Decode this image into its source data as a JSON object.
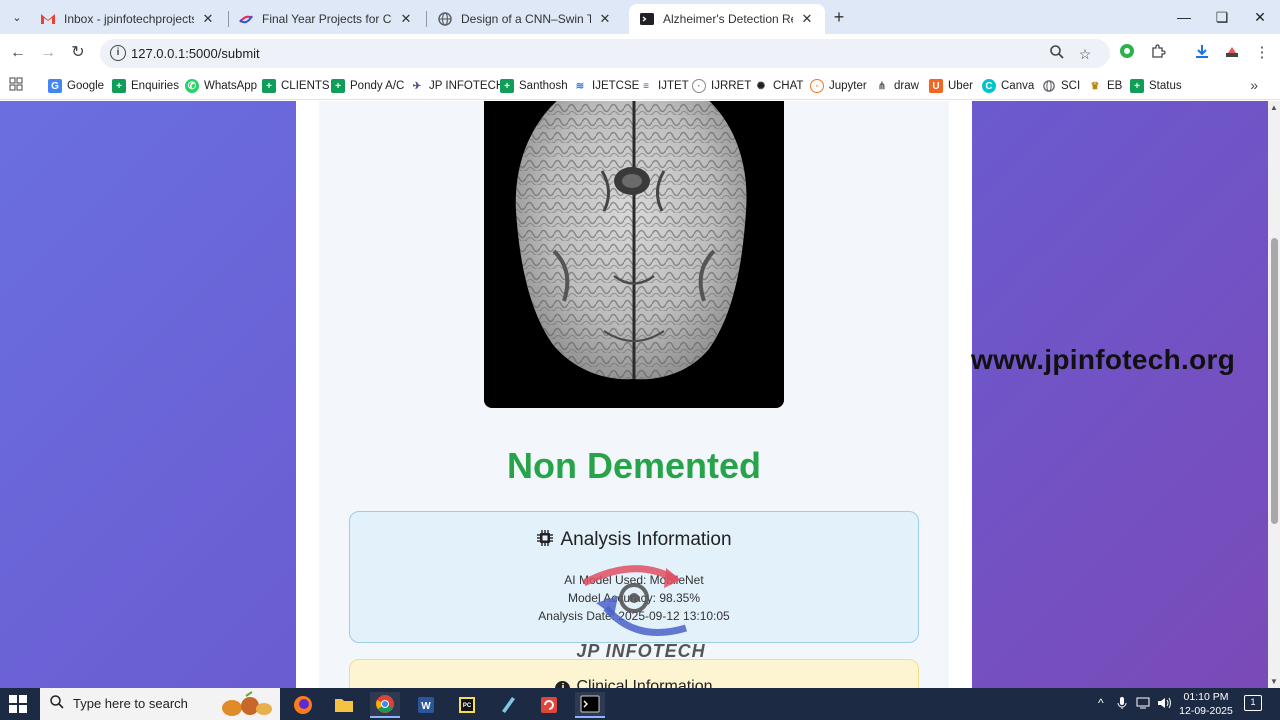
{
  "browser": {
    "tabs": [
      {
        "title": "Inbox - jpinfotechprojects@gm",
        "favicon": "gmail-icon",
        "favicon_color": "#ea4335",
        "active": false
      },
      {
        "title": "Final Year Projects for Compute",
        "favicon": "jp-logo-icon",
        "favicon_color": "#4a4a8a",
        "active": false
      },
      {
        "title": "Design of a CNN–Swin Transfor",
        "favicon": "globe-icon",
        "favicon_color": "#5f6368",
        "active": false
      },
      {
        "title": "Alzheimer's Detection Results",
        "favicon": "terminal-icon",
        "favicon_color": "#202124",
        "active": true
      }
    ],
    "url": "127.0.0.1:5000/submit",
    "bookmarks": [
      {
        "label": "Google",
        "icon": "google-icon",
        "color": "#4285f4"
      },
      {
        "label": "Enquiries",
        "icon": "sheets-icon",
        "color": "#0f9d58"
      },
      {
        "label": "WhatsApp",
        "icon": "whatsapp-icon",
        "color": "#25d366"
      },
      {
        "label": "CLIENTS",
        "icon": "sheets-icon",
        "color": "#0f9d58"
      },
      {
        "label": "Pondy A/C",
        "icon": "sheets-icon",
        "color": "#0f9d58"
      },
      {
        "label": "JP INFOTECH",
        "icon": "jp-logo-icon",
        "color": "#4a4a8a"
      },
      {
        "label": "Santhosh",
        "icon": "sheets-icon",
        "color": "#0f9d58"
      },
      {
        "label": "IJETCSE",
        "icon": "ijetcse-icon",
        "color": "#3a7bd5"
      },
      {
        "label": "IJTET",
        "icon": "ijtet-icon",
        "color": "#7b3fa0"
      },
      {
        "label": "IJRRET",
        "icon": "ijrret-icon",
        "color": "#888888"
      },
      {
        "label": "CHAT",
        "icon": "openai-icon",
        "color": "#202124"
      },
      {
        "label": "Jupyter",
        "icon": "jupyter-icon",
        "color": "#f37626"
      },
      {
        "label": "draw",
        "icon": "drawio-icon",
        "color": "#555555"
      },
      {
        "label": "Uber",
        "icon": "uber-icon",
        "color": "#f26522"
      },
      {
        "label": "Canva",
        "icon": "canva-icon",
        "color": "#00c4cc"
      },
      {
        "label": "SCI",
        "icon": "globe-icon",
        "color": "#5f6368"
      },
      {
        "label": "EB",
        "icon": "eb-icon",
        "color": "#b8860b"
      },
      {
        "label": "Status",
        "icon": "sheets-icon",
        "color": "#0f9d58"
      }
    ]
  },
  "page": {
    "result_label": "Non Demented",
    "result_color": "#27a34a",
    "analysis": {
      "title": "Analysis Information",
      "model_line": "AI Model Used: MobileNet",
      "accuracy_line": "Model Accuracy: 98.35%",
      "date_line": "Analysis Date: 2025-09-12 13:10:05"
    },
    "clinical": {
      "title": "Clinical Information"
    },
    "watermark": "www.jpinfotech.org",
    "logo_text": "JP INFOTECH"
  },
  "taskbar": {
    "search_placeholder": "Type here to search",
    "time": "01:10 PM",
    "date": "12-09-2025",
    "notification_count": "1"
  }
}
